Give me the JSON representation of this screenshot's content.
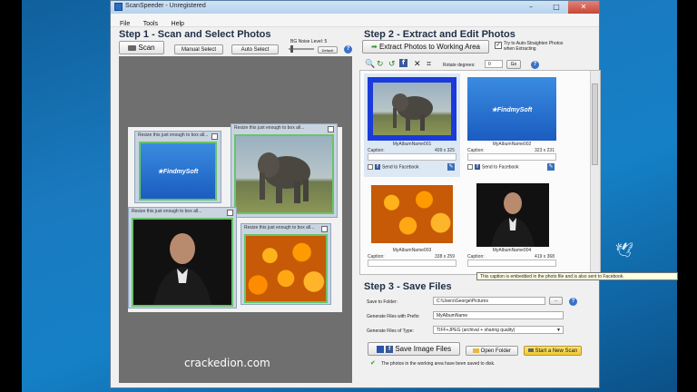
{
  "window": {
    "title": "ScanSpeeder - Unregistered"
  },
  "menu": [
    "File",
    "Tools",
    "Help"
  ],
  "step1": {
    "title": "Step 1 - Scan and Select Photos",
    "scan_label": "Scan",
    "manual_select_label": "Manual Select",
    "auto_select_label": "Auto Select",
    "bg_noise_label": "BG Noise Level: 5",
    "default_label": "Default",
    "photos": [
      {
        "hint": "Resize this just enough to box all..."
      },
      {
        "hint": "Resize this just enough to box all..."
      },
      {
        "hint": "Resize this just enough to box all..."
      },
      {
        "hint": "Resize this just enough to box all..."
      }
    ],
    "logo_text": "★FindmySoft"
  },
  "step2": {
    "title": "Step 2 - Extract and Edit Photos",
    "extract_label": "Extract Photos to Working Area",
    "auto_straighten_label": "Try to Auto-Straighten Photos when Extracting",
    "rotate_label": "Rotate degrees:",
    "rotate_value": "0",
    "go_label": "Go",
    "cards": [
      {
        "name": "MyAlbumName001",
        "caption_label": "Caption:",
        "dims": "409 x 325",
        "fb_label": "Send to Facebook"
      },
      {
        "name": "MyAlbumName002",
        "caption_label": "Caption:",
        "dims": "323 x 231",
        "fb_label": "Send to Facebook"
      },
      {
        "name": "MyAlbumName003",
        "caption_label": "Caption:",
        "dims": "338 x 259",
        "fb_label": ""
      },
      {
        "name": "MyAlbumName004",
        "caption_label": "Caption:",
        "dims": "419 x 368",
        "fb_label": ""
      }
    ],
    "tooltip": "This caption is embedded in the photo file and is also sent to Facebook."
  },
  "step3": {
    "title": "Step 3 - Save Files",
    "save_folder_label": "Save to Folder:",
    "save_folder_value": "C:\\Users\\George\\Pictures",
    "browse_label": "...",
    "prefix_label": "Generate Files with Prefix:",
    "prefix_value": "MyAlbumName",
    "type_label": "Generate Files of Type:",
    "type_value": "TIFF+JPEG (archival + sharing quality)",
    "save_images_label": "Save Image Files",
    "open_folder_label": "Open Folder",
    "new_scan_label": "Start a New Scan",
    "status_text": "The photos in the working area have been saved to disk."
  },
  "watermark": "crackedion.com",
  "colors": {
    "accent": "#3b5998",
    "selection_green": "#69c36b",
    "new_scan_yellow": "#f7d94a",
    "desktop_blue": "#1a7ac0"
  }
}
